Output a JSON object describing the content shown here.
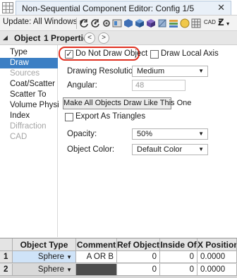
{
  "window": {
    "title": "Non-Sequential Component Editor: Config 1/5",
    "close_icon": "close-icon"
  },
  "toolbar": {
    "update_label": "Update: All Windows",
    "cad_label": "CAD",
    "z_label": "Z",
    "icons": [
      "refresh-icon",
      "refresh-all-icon",
      "settings-icon",
      "layout-icon",
      "solid-icon",
      "cube-icon",
      "cube-alt-icon",
      "slice-icon",
      "layers-icon",
      "color-icon",
      "grid-icon",
      "cad-dropdown-icon",
      "z-icon",
      "help-icon",
      "stop-icon"
    ]
  },
  "object_bar": {
    "object_label": "Object",
    "properties_label": "1 Properties"
  },
  "left_nav": {
    "items": [
      {
        "label": "Type",
        "state": "normal"
      },
      {
        "label": "Draw",
        "state": "selected"
      },
      {
        "label": "Sources",
        "state": "disabled"
      },
      {
        "label": "Coat/Scatter",
        "state": "normal"
      },
      {
        "label": "Scatter To",
        "state": "normal"
      },
      {
        "label": "Volume Physics",
        "state": "normal"
      },
      {
        "label": "Index",
        "state": "normal"
      },
      {
        "label": "Diffraction",
        "state": "disabled"
      },
      {
        "label": "CAD",
        "state": "disabled"
      }
    ]
  },
  "draw": {
    "do_not_draw_label": "Do Not Draw Object",
    "do_not_draw_checked": true,
    "draw_local_axis_label": "Draw Local Axis",
    "draw_local_axis_checked": false,
    "drawing_resolution_label": "Drawing Resolution:",
    "drawing_resolution_value": "Medium",
    "angular_label": "Angular:",
    "angular_value": "48",
    "make_all_button": "Make All Objects Draw Like This One",
    "export_triangles_label": "Export As Triangles",
    "export_triangles_checked": false,
    "opacity_label": "Opacity:",
    "opacity_value": "50%",
    "object_color_label": "Object Color:",
    "object_color_value": "Default Color"
  },
  "table": {
    "headers": [
      "Object Type",
      "Comment",
      "Ref Object",
      "Inside Of",
      "X Position"
    ],
    "rows": [
      {
        "num": "1",
        "type": "Sphere",
        "comment": "A OR B",
        "ref": "0",
        "inside": "0",
        "x": "0.0000"
      },
      {
        "num": "2",
        "type": "Sphere",
        "comment": "",
        "ref": "0",
        "inside": "0",
        "x": "0.0000"
      }
    ]
  },
  "colors": {
    "selected_nav": "#3c7fc4",
    "highlight_ring": "#e03020",
    "row_selected": "#cfe3f8"
  }
}
